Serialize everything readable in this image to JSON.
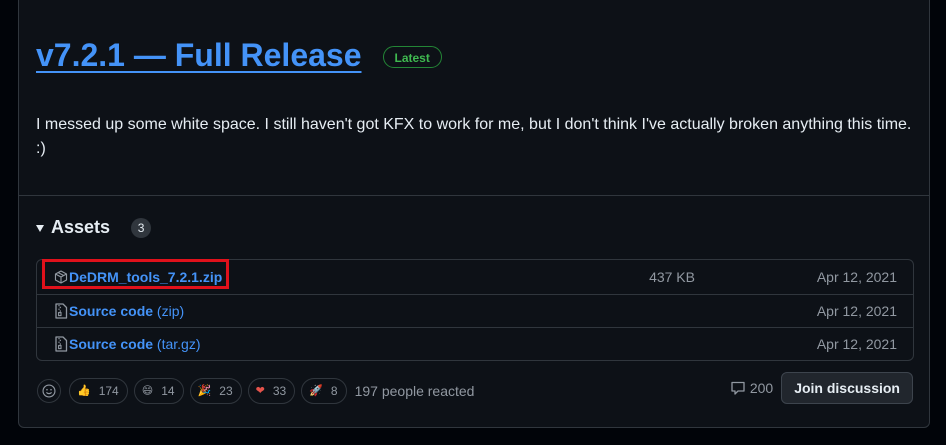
{
  "release": {
    "title": "v7.2.1 — Full Release",
    "badge": "Latest",
    "description": "I messed up some white space. I still haven't got KFX to work for me, but I don't think I've actually broken anything this time. :)"
  },
  "assets": {
    "label": "Assets",
    "count": "3",
    "items": [
      {
        "name": "DeDRM_tools_7.2.1.zip",
        "suffix": "",
        "size": "437 KB",
        "date": "Apr 12, 2021",
        "icon": "package-icon"
      },
      {
        "name": "Source code",
        "suffix": " (zip)",
        "size": "",
        "date": "Apr 12, 2021",
        "icon": "file-zip-icon"
      },
      {
        "name": "Source code",
        "suffix": " (tar.gz)",
        "size": "",
        "date": "Apr 12, 2021",
        "icon": "file-zip-icon"
      }
    ]
  },
  "reactions": {
    "items": [
      {
        "emoji": "👍",
        "icon": "thumbs-up-icon",
        "count": "174"
      },
      {
        "emoji": "😄",
        "icon": "laugh-icon",
        "count": "14"
      },
      {
        "emoji": "🎉",
        "icon": "hooray-icon",
        "count": "23"
      },
      {
        "emoji": "❤",
        "icon": "heart-icon",
        "count": "33"
      },
      {
        "emoji": "🚀",
        "icon": "rocket-icon",
        "count": "8"
      }
    ],
    "summary": "197 people reacted"
  },
  "discussion": {
    "comment_count": "200",
    "join_label": "Join discussion"
  },
  "colors": {
    "link": "#4493f8",
    "badge_green": "#3fb950",
    "highlight_red": "#e0111b"
  }
}
